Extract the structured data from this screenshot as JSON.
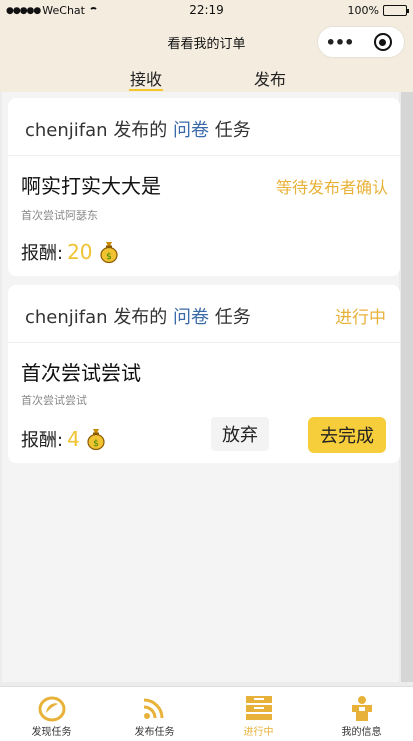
{
  "status_bar": {
    "signal_dots": "●●●●●",
    "carrier": "WeChat",
    "time": "22:19",
    "battery": "100%",
    "battery_level": 1.0
  },
  "nav": {
    "title": "看看我的订单",
    "more_icon": "more-dots-icon",
    "close_icon": "target-circle-icon"
  },
  "tabs": [
    {
      "label": "接收",
      "active": true
    },
    {
      "label": "发布",
      "active": false
    }
  ],
  "orders": [
    {
      "publisher": "chenjifan",
      "published_text": "发布的",
      "type": "问卷",
      "task_text": "任务",
      "header_status": "",
      "title": "啊实打实大大是",
      "status": "等待发布者确认",
      "description": "首次尝试阿瑟东",
      "reward_label": "报酬:",
      "reward_amount": "20",
      "reward_icon": "money-bag-icon"
    },
    {
      "publisher": "chenjifan",
      "published_text": "发布的",
      "type": "问卷",
      "task_text": "任务",
      "header_status": "进行中",
      "title": "首次尝试尝试",
      "status": "",
      "description": "首次尝试尝试",
      "reward_label": "报酬:",
      "reward_amount": "4",
      "reward_icon": "money-bag-icon",
      "abandon_label": "放弃",
      "finish_label": "去完成"
    }
  ],
  "tabbar": [
    {
      "label": "发现任务",
      "icon": "discover-icon",
      "active": false
    },
    {
      "label": "发布任务",
      "icon": "rss-icon",
      "active": false
    },
    {
      "label": "进行中",
      "icon": "in-progress-icon",
      "active": true
    },
    {
      "label": "我的信息",
      "icon": "profile-icon",
      "active": false
    }
  ],
  "colors": {
    "accent": "#f6cd3a",
    "status_text": "#e8b23a",
    "keyword": "#3b6aa8",
    "header_bg": "#f3ecdf"
  }
}
